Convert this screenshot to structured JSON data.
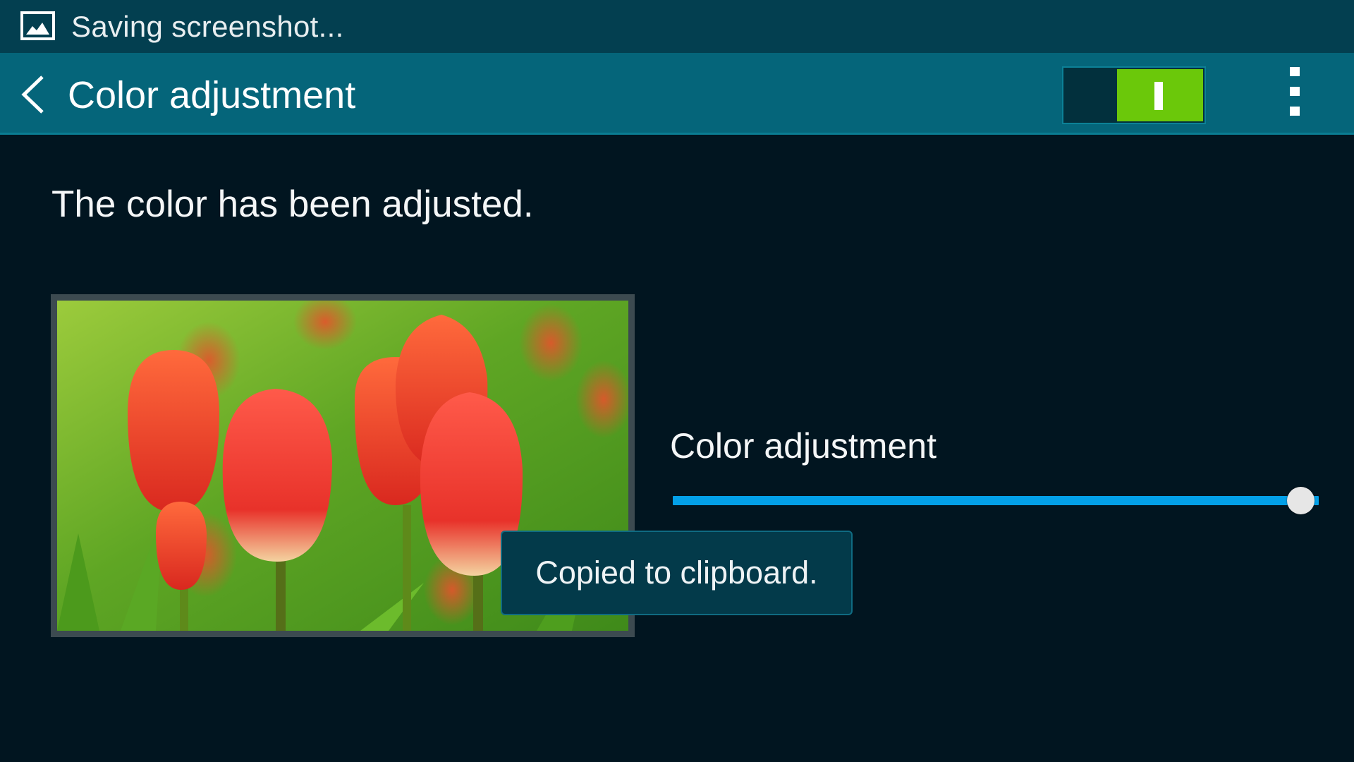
{
  "status_bar": {
    "notification_icon": "image-icon",
    "text": "Saving screenshot..."
  },
  "action_bar": {
    "back_icon": "chevron-left-icon",
    "title": "Color adjustment",
    "master_switch": {
      "state": "on",
      "on_color": "#6bc80a"
    },
    "overflow_icon": "more-vertical-icon"
  },
  "content": {
    "headline": "The color has been adjusted.",
    "preview_image": "red-tulips-photo",
    "slider": {
      "label": "Color adjustment",
      "value_fraction": 1.0,
      "track_color": "#03a0e8"
    }
  },
  "toast": {
    "text": "Copied to clipboard."
  }
}
